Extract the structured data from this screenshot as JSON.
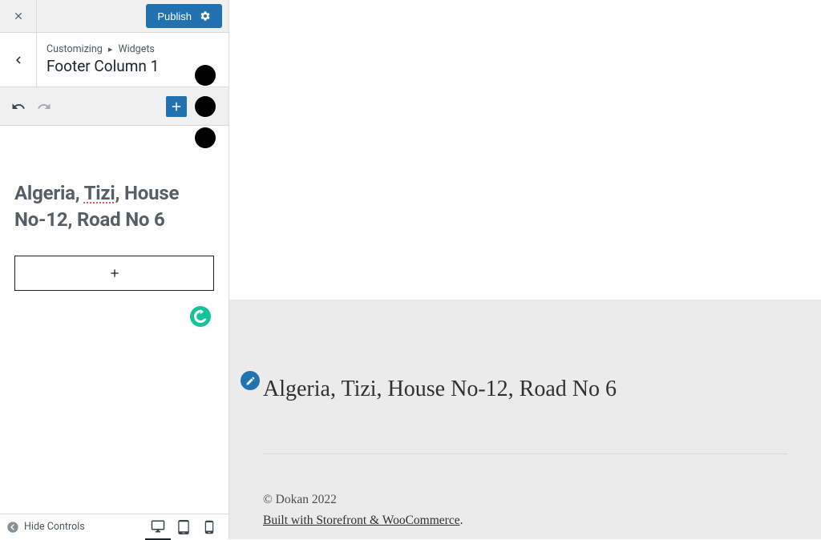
{
  "header": {
    "publish_label": "Publish"
  },
  "section": {
    "crumb_customizing": "Customizing",
    "crumb_separator": "▸",
    "crumb_widgets": "Widgets",
    "title": "Footer Column 1"
  },
  "editor": {
    "heading_part1": "Algeria, ",
    "heading_part2_tizi": "Tizi",
    "heading_part3": ", House No-12, Road No 6"
  },
  "footer": {
    "hide_controls_label": "Hide Controls"
  },
  "preview": {
    "heading": "Algeria, Tizi, House No-12, Road No 6",
    "copyright": "© Dokan 2022",
    "credits_text": "Built with Storefront & WooCommerce",
    "credits_suffix": "."
  }
}
